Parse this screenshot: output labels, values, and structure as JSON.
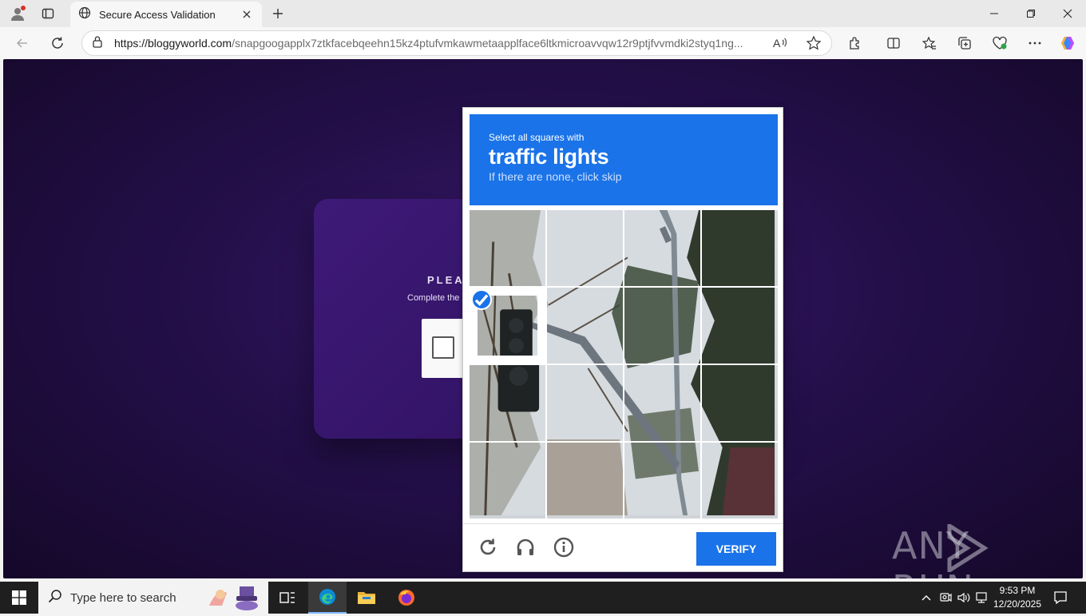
{
  "browser": {
    "tab_title": "Secure Access Validation",
    "url_domain": "https://bloggyworld.com",
    "url_path": "/snapgoogapplx7ztkfacebqeehn15kz4ptufvmkawmetaapplface6ltkmicroavvqw12r9ptjfvvmdki2styq1ng..."
  },
  "page": {
    "card_heading": "PLEAS",
    "card_sub": "Complete the",
    "watermark": "ANY RUN"
  },
  "captcha": {
    "instruction": "Select all squares with",
    "target": "traffic lights",
    "hint": "If there are none, click skip",
    "verify_label": "VERIFY",
    "selected_tiles": [
      4
    ]
  },
  "taskbar": {
    "search_placeholder": "Type here to search",
    "time": "9:53 PM",
    "date": "12/20/2025"
  },
  "colors": {
    "accent": "#1a73e8",
    "page_bg": "#240f4a"
  }
}
